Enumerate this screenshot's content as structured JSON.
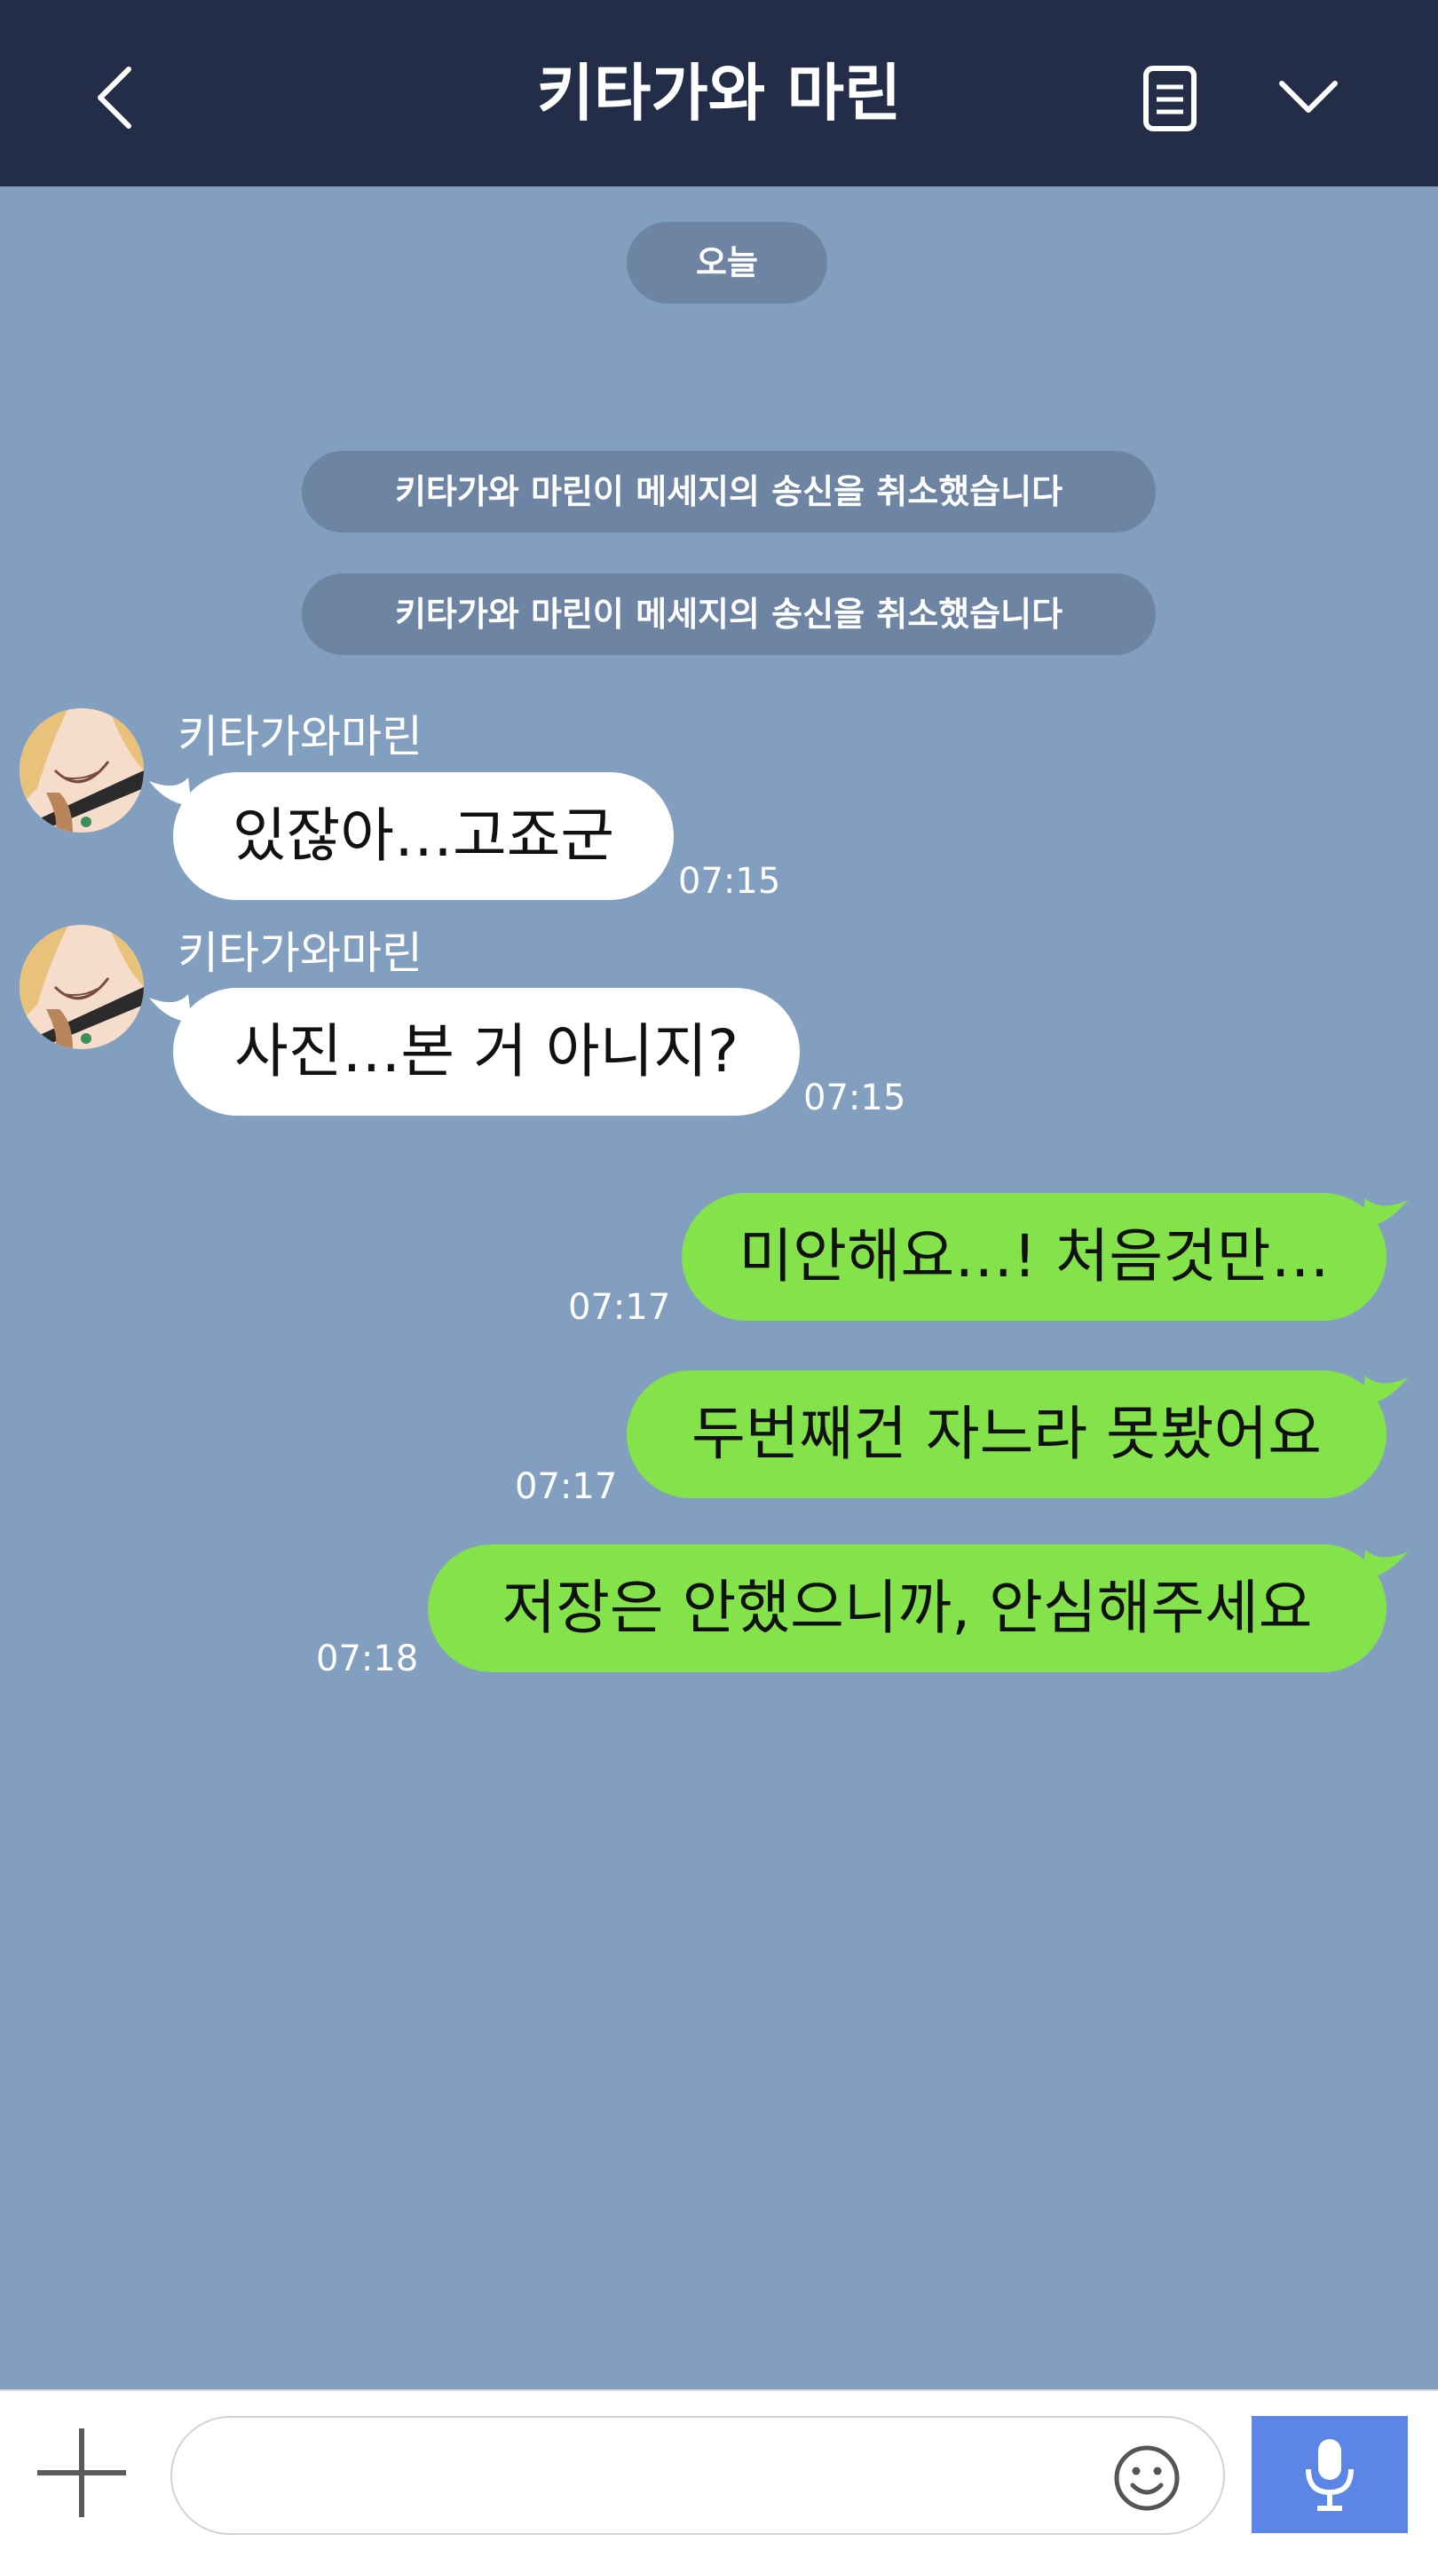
{
  "header": {
    "title": "키타가와 마린"
  },
  "date_divider": "오늘",
  "system_notices": [
    "키타가와 마린이 메세지의 송신을 취소했습니다",
    "키타가와 마린이 메세지의 송신을 취소했습니다"
  ],
  "messages": [
    {
      "direction": "incoming",
      "sender": "키타가와마린",
      "text": "있잖아…고죠군",
      "time": "07:15"
    },
    {
      "direction": "incoming",
      "sender": "키타가와마린",
      "text": "사진…본 거 아니지?",
      "time": "07:15"
    },
    {
      "direction": "outgoing",
      "text": "미안해요…! 처음것만…",
      "time": "07:17"
    },
    {
      "direction": "outgoing",
      "text": "두번째건 자느라 못봤어요",
      "time": "07:17"
    },
    {
      "direction": "outgoing",
      "text": "저장은 안했으니까, 안심해주세요",
      "time": "07:18"
    }
  ],
  "input": {
    "value": "",
    "placeholder": ""
  },
  "icons": {
    "back": "chevron-left-icon",
    "notes": "notes-icon",
    "menu": "chevron-down-icon",
    "add": "plus-icon",
    "emoji": "smiley-icon",
    "mic": "microphone-icon"
  },
  "colors": {
    "header_bg": "#232d47",
    "chat_bg": "#839fbf",
    "outgoing_bubble": "#84e34b",
    "incoming_bubble": "#ffffff",
    "notice_pill": "#6e84a3",
    "mic_button": "#5b86e6"
  }
}
